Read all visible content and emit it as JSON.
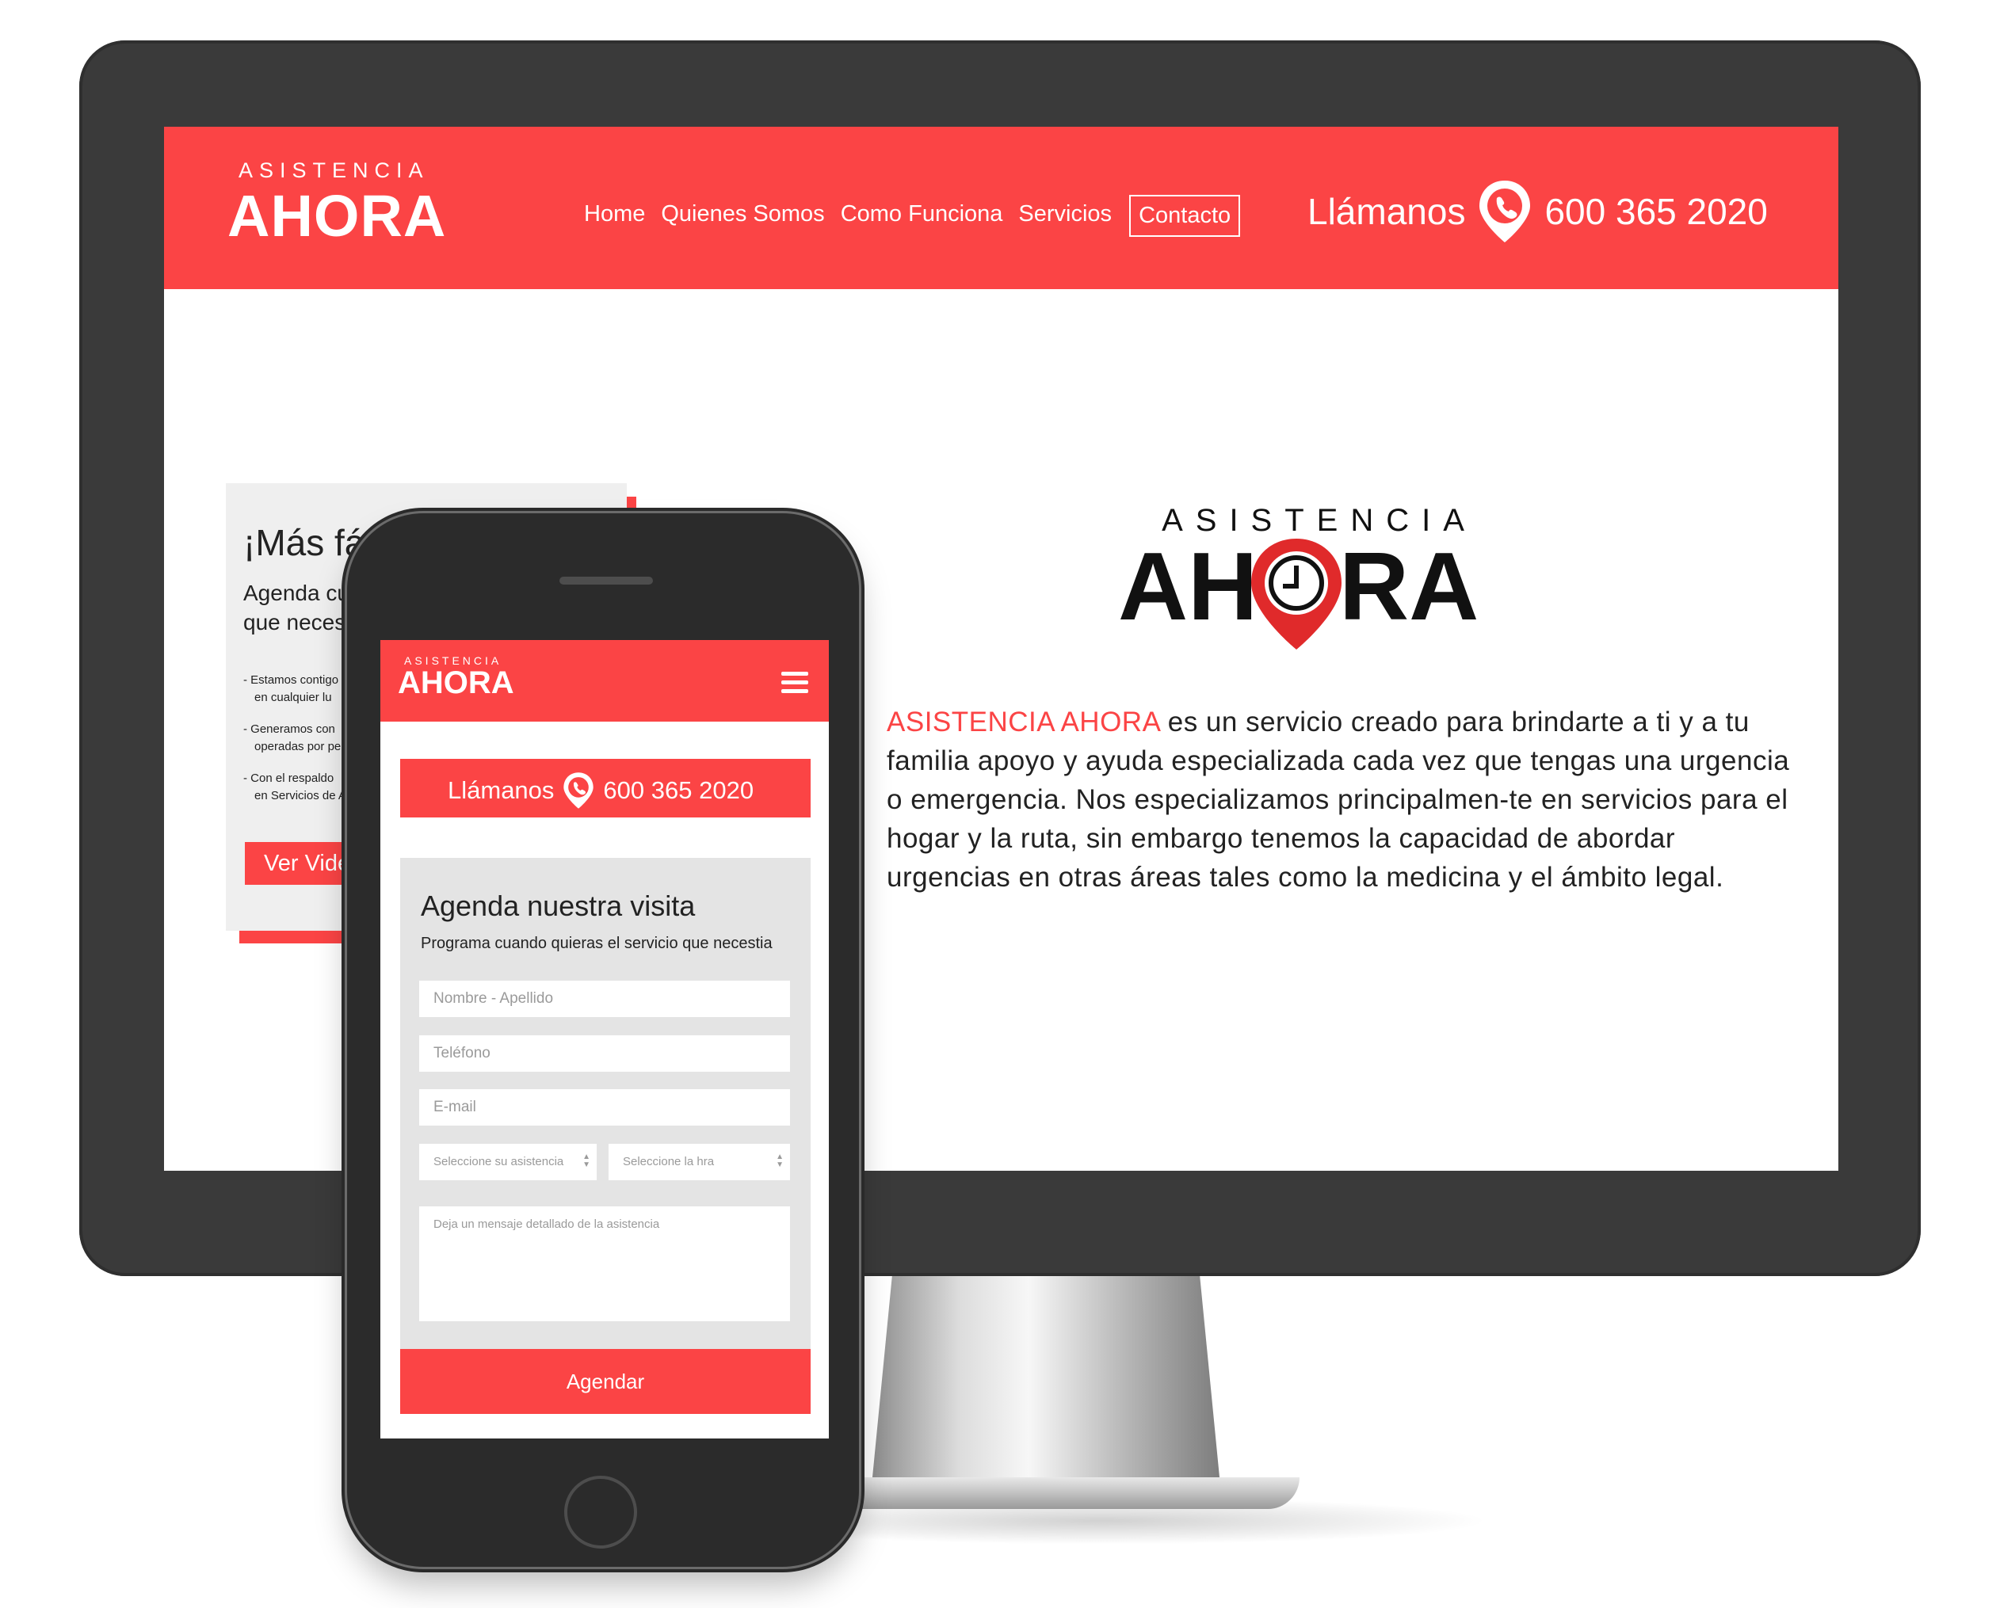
{
  "desktop": {
    "logo": {
      "top": "ASISTENCIA",
      "main": "AHORA"
    },
    "nav": [
      "Home",
      "Quienes Somos",
      "Como Funciona",
      "Servicios",
      "Contacto"
    ],
    "active_nav": "Contacto",
    "call": {
      "label": "Llámanos",
      "phone": "600 365 2020"
    },
    "card": {
      "title": "¡Más fá",
      "sub_line1": "Agenda cu",
      "sub_line2": "que neces",
      "bullets": [
        {
          "l1": "- Estamos contigo",
          "l2": "en cualquier  lu"
        },
        {
          "l1": "- Generamos con",
          "l2": "operadas por pe"
        },
        {
          "l1": "- Con el respaldo",
          "l2": "en Servicios de A"
        }
      ],
      "button": "Ver Vide"
    },
    "brand_logo": {
      "top": "ASISTENCIA",
      "main": "AHORA"
    },
    "description": {
      "brand": "ASISTENCIA AHORA",
      "text": " es un servicio creado para brindarte a ti y a tu familia apoyo y ayuda especializada cada vez que tengas una urgencia o emergencia. Nos especializamos principalmen-te en servicios para el hogar y la ruta, sin embargo tenemos la capacidad de abordar urgencias en otras áreas tales como la medicina y el ámbito legal."
    }
  },
  "mobile": {
    "logo": {
      "top": "ASISTENCIA",
      "main": "AHORA"
    },
    "call": {
      "label": "Llámanos",
      "phone": "600 365 2020"
    },
    "form": {
      "title": "Agenda nuestra visita",
      "subtitle": "Programa cuando quieras el servicio que necestia",
      "name_placeholder": "Nombre - Apellido",
      "phone_placeholder": "Teléfono",
      "email_placeholder": "E-mail",
      "assist_select": "Seleccione su asistencia",
      "time_select": "Seleccione la hra",
      "message_placeholder": "Deja un mensaje detallado de la asistencia",
      "submit": "Agendar"
    }
  },
  "colors": {
    "brand_red": "#fb4445",
    "bezel": "#3a3a3a",
    "form_bg": "#e4e4e4"
  }
}
